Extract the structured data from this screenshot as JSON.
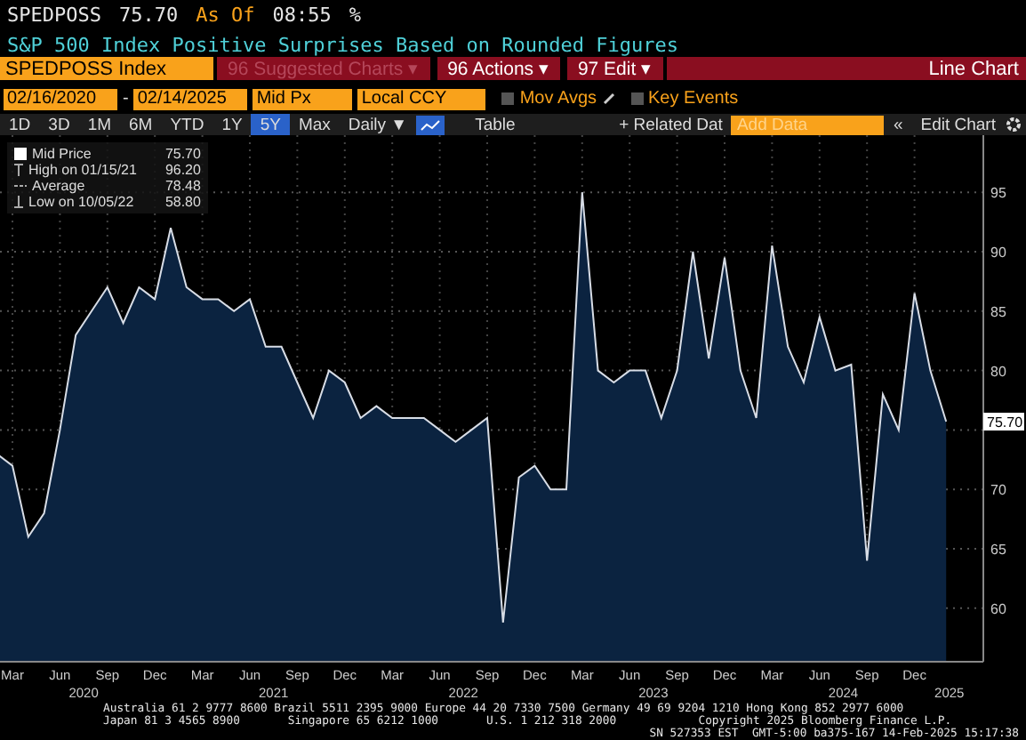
{
  "header": {
    "ticker": "SPEDPOSS",
    "price": "75.70",
    "as_of_label": "As Of",
    "time": "08:55",
    "unit": "%",
    "description": "S&P 500 Index Positive Surprises Based on Rounded Figures"
  },
  "command_bar": {
    "security": "SPEDPOSS Index",
    "menus": [
      {
        "icon": "96",
        "label": "Suggested Charts ▾",
        "disabled": true
      },
      {
        "icon": "96",
        "label": "Actions ▾",
        "disabled": false
      },
      {
        "icon": "97",
        "label": "Edit ▾",
        "disabled": false
      }
    ],
    "title": "Line Chart"
  },
  "settings_bar": {
    "start_date": "02/16/2020",
    "separator": "-",
    "end_date": "02/14/2025",
    "field": "Mid Px",
    "currency": "Local CCY",
    "toggles": [
      {
        "label": "Mov Avgs",
        "checked": false,
        "editable": true
      },
      {
        "label": "Key Events",
        "checked": false,
        "editable": false
      }
    ]
  },
  "toolbar": {
    "ranges": [
      {
        "label": "1D",
        "selected": false
      },
      {
        "label": "3D",
        "selected": false
      },
      {
        "label": "1M",
        "selected": false
      },
      {
        "label": "6M",
        "selected": false
      },
      {
        "label": "YTD",
        "selected": false
      },
      {
        "label": "1Y",
        "selected": false
      },
      {
        "label": "5Y",
        "selected": true
      },
      {
        "label": "Max",
        "selected": false
      }
    ],
    "frequency": "Daily ▼",
    "table": "Table",
    "related": "+ Related Dat",
    "add_data_placeholder": "Add Data",
    "collapse": "«",
    "edit_chart": "Edit Chart"
  },
  "legend": [
    {
      "kind": "series",
      "value": "75.70"
    },
    {
      "kind": "high",
      "label": "High on 01/15/21",
      "value": "96.20"
    },
    {
      "kind": "average",
      "label": "Average",
      "value": "78.48"
    },
    {
      "kind": "low",
      "label": "Low on 10/05/22",
      "value": "58.80"
    }
  ],
  "last_value_tag": "75.70",
  "x_axis_years": [
    "2020",
    "2021",
    "2022",
    "2023",
    "2024",
    "2025"
  ],
  "chart_data": {
    "type": "area",
    "ylim": [
      55.5,
      99.8
    ],
    "grid": true,
    "yticks": [
      60,
      65,
      70,
      80,
      85,
      90,
      95
    ],
    "categories": [
      null,
      "Mar",
      null,
      null,
      "Jun",
      null,
      null,
      "Sep",
      null,
      null,
      "Dec",
      null,
      null,
      "Mar",
      null,
      null,
      "Jun",
      null,
      null,
      "Sep",
      null,
      null,
      "Dec",
      null,
      null,
      "Mar",
      null,
      null,
      "Jun",
      null,
      null,
      "Sep",
      null,
      null,
      "Dec",
      null,
      null,
      "Mar",
      null,
      null,
      "Jun",
      null,
      null,
      "Sep",
      null,
      null,
      "Dec",
      null,
      null,
      "Mar",
      null,
      null,
      "Jun",
      null,
      null,
      "Sep",
      null,
      null,
      "Dec",
      null,
      null
    ],
    "series": [
      {
        "name": "Mid Price",
        "color": "#d8dde6",
        "values": [
          73,
          72,
          66,
          68,
          75,
          83,
          85,
          87,
          84,
          87,
          86,
          92,
          87,
          86,
          86,
          85,
          86,
          82,
          82,
          79,
          76,
          80,
          79,
          76,
          77,
          76,
          76,
          76,
          75,
          74,
          75,
          76,
          58.8,
          71,
          72,
          70,
          70,
          95,
          80,
          79,
          80,
          80,
          76,
          80,
          90,
          81,
          89.5,
          80,
          76,
          90.5,
          82,
          79,
          84.5,
          80,
          80.5,
          64,
          78,
          75,
          86.5,
          80,
          75.7
        ]
      }
    ]
  },
  "footer": [
    "Australia 61 2 9777 8600 Brazil 5511 2395 9000 Europe 44 20 7330 7500 Germany 49 69 9204 1210 Hong Kong 852 2977 6000",
    "Japan 81 3 4565 8900       Singapore 65 6212 1000       U.S. 1 212 318 2000            Copyright 2025 Bloomberg Finance L.P.",
    "SN 527353 EST  GMT-5:00 ba375-167 14-Feb-2025 15:17:38"
  ]
}
